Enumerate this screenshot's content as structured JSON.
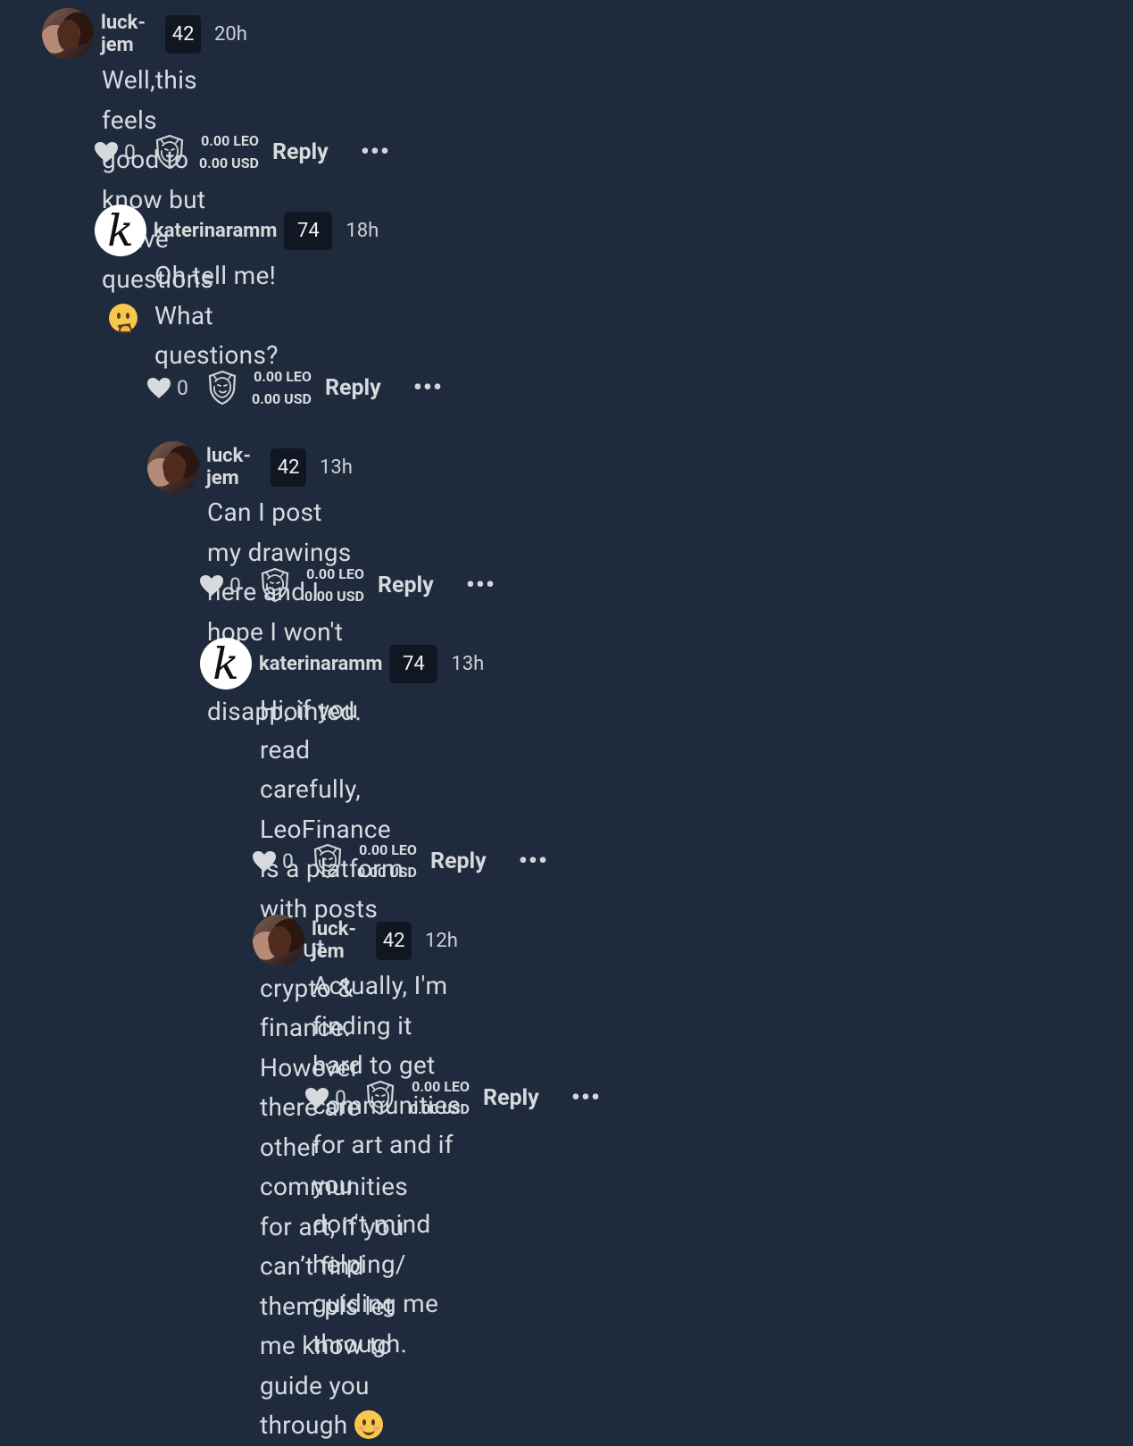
{
  "comments": [
    {
      "username": "luck-jem",
      "reputation": "42",
      "time": "20h",
      "lines": [
        "Well,this feels good to know but I have questions"
      ],
      "emoji": "thinking-face-icon",
      "likes": "0",
      "leo": "0.00 LEO",
      "usd": "0.00 USD",
      "reply": "Reply",
      "more": "•••"
    },
    {
      "username": "katerinaramm",
      "avatar_letter": "k",
      "reputation": "74",
      "time": "18h",
      "lines": [
        "Oh tell me!",
        "What questions?"
      ],
      "likes": "0",
      "leo": "0.00 LEO",
      "usd": "0.00 USD",
      "reply": "Reply",
      "more": "•••"
    },
    {
      "username": "luck-jem",
      "reputation": "42",
      "time": "13h",
      "lines": [
        "Can I post my drawings here and I hope I won't be disappointed."
      ],
      "likes": "0",
      "leo": "0.00 LEO",
      "usd": "0.00 USD",
      "reply": "Reply",
      "more": "•••"
    },
    {
      "username": "katerinaramm",
      "avatar_letter": "k",
      "reputation": "74",
      "time": "13h",
      "lines": [
        "Hi, if you read carefully, LeoFinance is a platform with posts about",
        "crypto & finance. However there are other communities for art, if you",
        "can’t find them pls let me know to guide you through"
      ],
      "emoji": "smiling-face-icon",
      "likes": "0",
      "leo": "0.00 LEO",
      "usd": "0.00 USD",
      "reply": "Reply",
      "more": "•••"
    },
    {
      "username": "luck-jem",
      "reputation": "42",
      "time": "12h",
      "lines": [
        "Actually, I'm finding it hard to get communities for art and if you",
        "don't mind helping/ guiding me through."
      ],
      "likes": "0",
      "leo": "0.00 LEO",
      "usd": "0.00 USD",
      "reply": "Reply",
      "more": "•••"
    }
  ],
  "colors": {
    "background": "#1f2a3c",
    "text": "#d7dbe0",
    "reputation_badge": "#101722"
  }
}
